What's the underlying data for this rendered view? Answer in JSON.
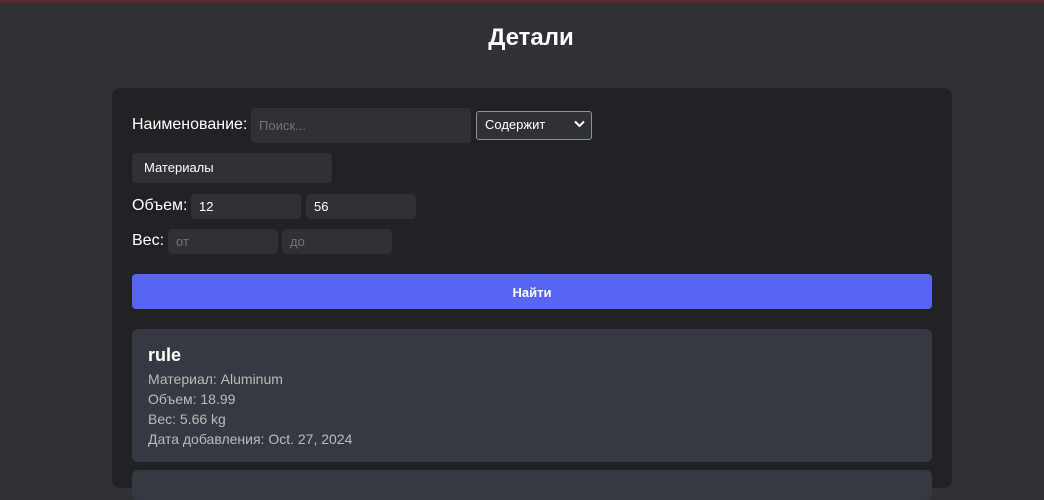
{
  "page": {
    "title": "Детали"
  },
  "filters": {
    "name_label": "Наименование:",
    "name_placeholder": "Поиск...",
    "name_value": "",
    "match_mode": "Содержит",
    "material_value": "Материалы",
    "volume_label": "Объем:",
    "volume_from": "12",
    "volume_to": "56",
    "weight_label": "Вес:",
    "weight_from_placeholder": "от",
    "weight_to_placeholder": "до",
    "find_label": "Найти"
  },
  "results": [
    {
      "name": "rule",
      "material": "Материал: Aluminum",
      "volume": "Объем: 18.99",
      "weight": "Вес: 5.66 kg",
      "date_added": "Дата добавления: Oct. 27, 2024"
    }
  ],
  "colors": {
    "accent_button": "#5865f2",
    "page_background": "#2f3136",
    "panel_background": "#202225",
    "card_background": "#36393f"
  }
}
